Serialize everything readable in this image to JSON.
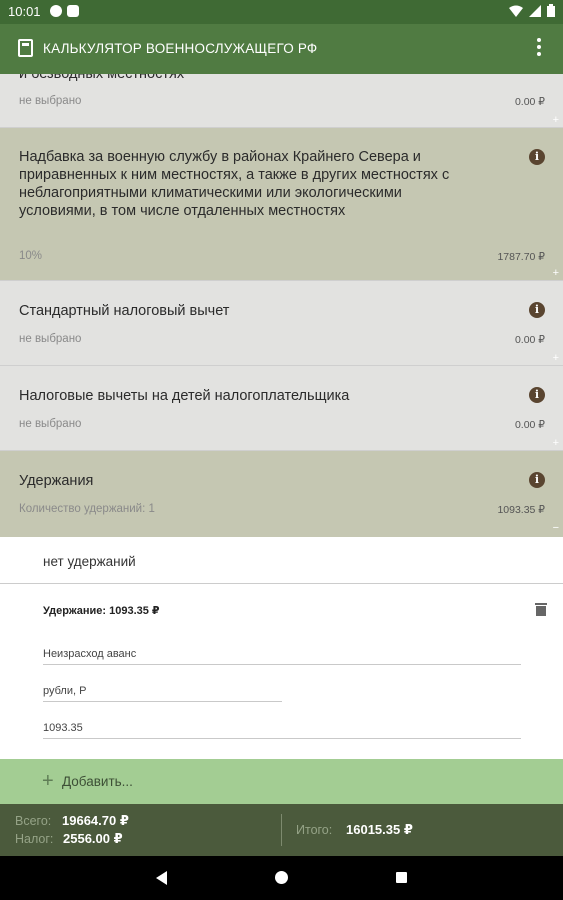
{
  "status_bar": {
    "time": "10:01",
    "icons": [
      "app-icon-1",
      "app-icon-2",
      "wifi-icon",
      "signal-icon",
      "battery-icon"
    ]
  },
  "app_bar": {
    "title": "КАЛЬКУЛЯТОР ВОЕННОСЛУЖАЩЕГО РФ"
  },
  "cards": [
    {
      "title": "и безводных местностях",
      "subtitle": "не выбрано",
      "amount": "0.00 ₽"
    },
    {
      "title": "Надбавка за военную службу в районах Крайнего Севера и приравненных к ним местностях, а также в других местностях с неблагоприятными климатическими или экологическими условиями, в том числе отдаленных местностях",
      "subtitle": "10%",
      "amount": "1787.70 ₽"
    },
    {
      "title": "Стандартный налоговый вычет",
      "subtitle": "не выбрано",
      "amount": "0.00 ₽"
    },
    {
      "title": "Налоговые вычеты на детей налогоплательщика",
      "subtitle": "не выбрано",
      "amount": "0.00 ₽"
    },
    {
      "title": "Удержания",
      "subtitle": "Количество удержаний: 1",
      "amount": "1093.35 ₽"
    }
  ],
  "deductions": {
    "none_label": "нет удержаний",
    "item_title": "Удержание: 1093.35 ₽",
    "name_value": "Неизрасход аванс",
    "unit_value": "рубли, Р",
    "amount_value": "1093.35"
  },
  "add_button": {
    "label": "Добавить..."
  },
  "totals": {
    "total_label": "Всего:",
    "total_value": "19664.70 ₽",
    "tax_label": "Налог:",
    "tax_value": "2556.00 ₽",
    "result_label": "Итого:",
    "result_value": "16015.35 ₽"
  },
  "colors": {
    "app_bar": "#507b42",
    "status_bar": "#3f6a34",
    "card_grey": "#e2e2e0",
    "card_olive": "#c5c7b2",
    "add_bar": "#a3cd93",
    "bottom_bar": "#4b5a3c"
  }
}
